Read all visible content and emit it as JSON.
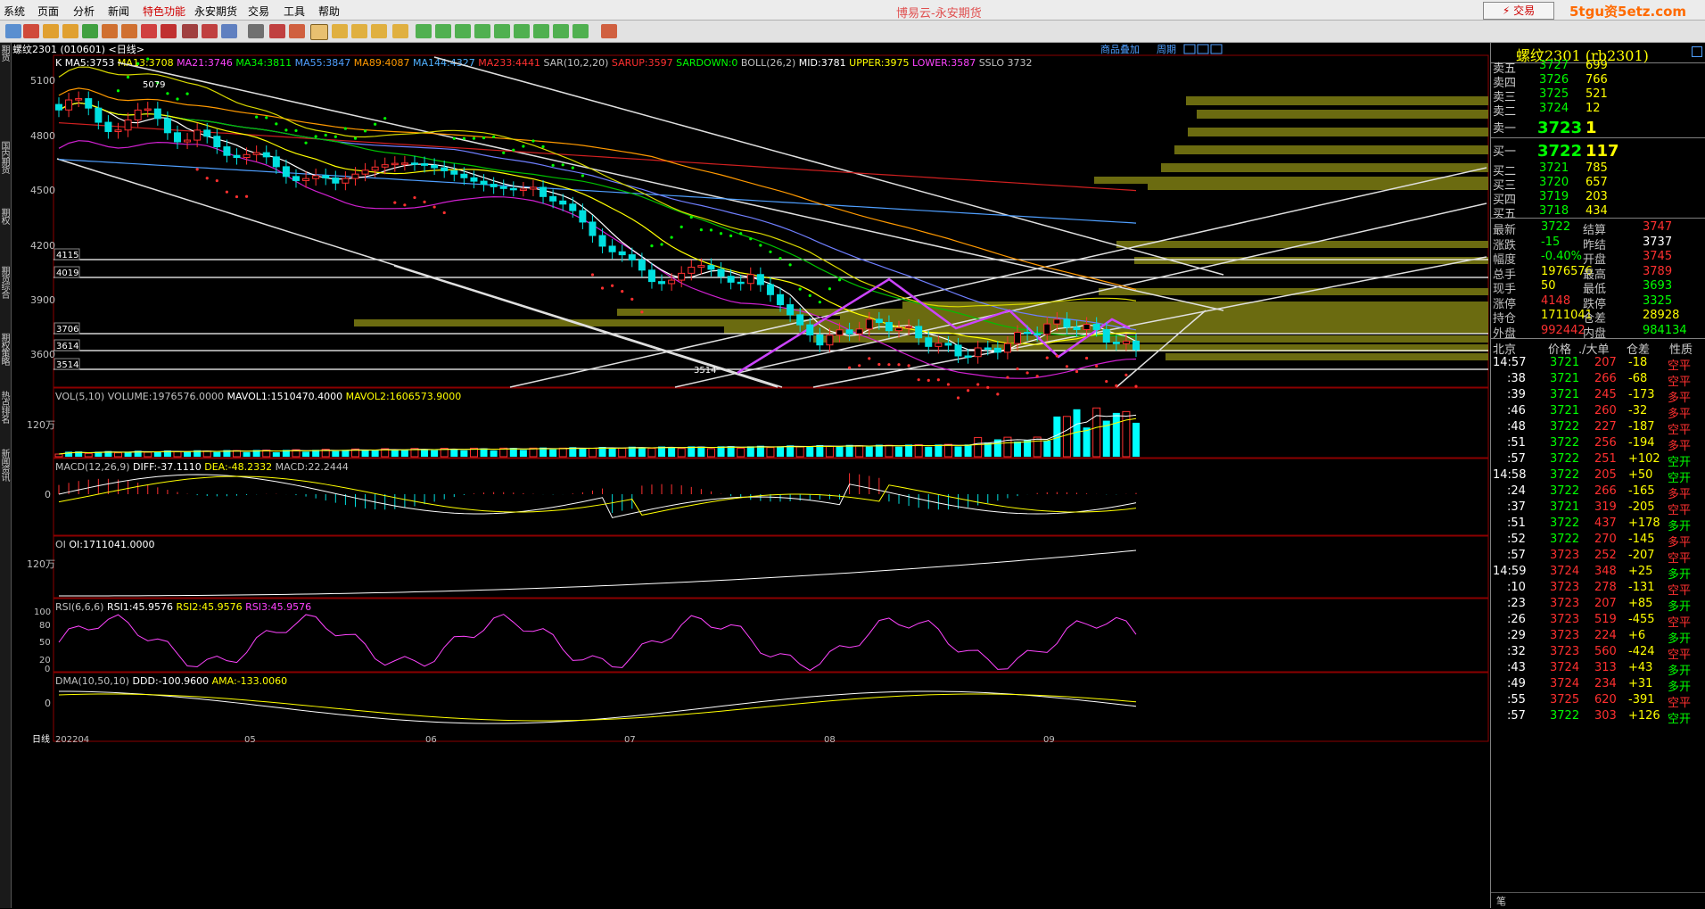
{
  "menu": [
    "系统",
    "页面",
    "分析",
    "新闻",
    "特色功能",
    "永安期货",
    "交易",
    "工具",
    "帮助"
  ],
  "app_title": "博易云-永安期货",
  "trade_button": "交易",
  "watermark": "5tgu资5etz.com",
  "side_tabs": [
    "期货",
    "国内期货",
    "期权",
    "期货综合",
    "期权策略",
    "热点排名",
    "新闻资讯"
  ],
  "chart_header": "螺纹2301 (010601) <日线>",
  "chart_links": [
    "商品叠加",
    "周期"
  ],
  "main_indicator_row": [
    {
      "t": "K",
      "c": "#ffffff"
    },
    {
      "t": "MA5:3753",
      "c": "#ffffff"
    },
    {
      "t": "MA13:3708",
      "c": "#ffff00"
    },
    {
      "t": "MA21:3746",
      "c": "#ff44ff"
    },
    {
      "t": "MA34:3811",
      "c": "#00ff00"
    },
    {
      "t": "MA55:3847",
      "c": "#4f9fff"
    },
    {
      "t": "MA89:4087",
      "c": "#ff9900"
    },
    {
      "t": "MA144:4327",
      "c": "#4fb0ff"
    },
    {
      "t": "MA233:4441",
      "c": "#ff3030"
    },
    {
      "t": "SAR(10,2,20)",
      "c": "#c0c0c0"
    },
    {
      "t": "SARUP:3597",
      "c": "#ff3030"
    },
    {
      "t": "SARDOWN:0",
      "c": "#00ff00"
    },
    {
      "t": "BOLL(26,2)",
      "c": "#c0c0c0"
    },
    {
      "t": "MID:3781",
      "c": "#ffffff"
    },
    {
      "t": "UPPER:3975",
      "c": "#ffff00"
    },
    {
      "t": "LOWER:3587",
      "c": "#ff44ff"
    },
    {
      "t": "SSLO 3732",
      "c": "#c0c0c0"
    }
  ],
  "price_axis": [
    "5100",
    "4800",
    "4500",
    "4200",
    "3900",
    "3600"
  ],
  "price_levels": [
    "4115",
    "4019",
    "3706",
    "3614",
    "3514"
  ],
  "annotations": {
    "high": "5079",
    "low": "3514"
  },
  "vol_row": [
    {
      "t": "VOL(5,10)",
      "c": "#c0c0c0"
    },
    {
      "t": "VOLUME:1976576.0000",
      "c": "#c0c0c0"
    },
    {
      "t": "MAVOL1:1510470.4000",
      "c": "#ffffff"
    },
    {
      "t": "MAVOL2:1606573.9000",
      "c": "#ffff00"
    }
  ],
  "vol_axis": "120万",
  "macd_row": [
    {
      "t": "MACD(12,26,9)",
      "c": "#c0c0c0"
    },
    {
      "t": "DIFF:-37.1110",
      "c": "#ffffff"
    },
    {
      "t": "DEA:-48.2332",
      "c": "#ffff00"
    },
    {
      "t": "MACD:22.2444",
      "c": "#c0c0c0"
    }
  ],
  "macd_axis": "0",
  "oi_row": [
    {
      "t": "OI",
      "c": "#c0c0c0"
    },
    {
      "t": "OI:1711041.0000",
      "c": "#ffffff"
    }
  ],
  "oi_axis": "120万",
  "rsi_row": [
    {
      "t": "RSI(6,6,6)",
      "c": "#c0c0c0"
    },
    {
      "t": "RSI1:45.9576",
      "c": "#ffffff"
    },
    {
      "t": "RSI2:45.9576",
      "c": "#ffff00"
    },
    {
      "t": "RSI3:45.9576",
      "c": "#ff44ff"
    }
  ],
  "rsi_axis": [
    "100",
    "80",
    "50",
    "20",
    "0"
  ],
  "dma_row": [
    {
      "t": "DMA(10,50,10)",
      "c": "#c0c0c0"
    },
    {
      "t": "DDD:-100.9600",
      "c": "#ffffff"
    },
    {
      "t": "AMA:-133.0060",
      "c": "#ffff00"
    }
  ],
  "dma_axis": "0",
  "time_axis": [
    "日线",
    "202204",
    "05",
    "06",
    "07",
    "08",
    "09"
  ],
  "quote": {
    "title": "螺纹2301 (rb2301)",
    "asks": [
      [
        "卖五",
        "3727",
        "699"
      ],
      [
        "卖四",
        "3726",
        "766"
      ],
      [
        "卖三",
        "3725",
        "521"
      ],
      [
        "卖二",
        "3724",
        "12"
      ]
    ],
    "ask1": [
      "卖一",
      "3723",
      "1"
    ],
    "bid1": [
      "买一",
      "3722",
      "117"
    ],
    "bids": [
      [
        "买二",
        "3721",
        "785"
      ],
      [
        "买三",
        "3720",
        "657"
      ],
      [
        "买四",
        "3719",
        "203"
      ],
      [
        "买五",
        "3718",
        "434"
      ]
    ],
    "stats": [
      [
        {
          "t": "最新",
          "c": "#c0c0c0"
        },
        {
          "t": "3722",
          "c": "#00ff00"
        },
        {
          "t": "结算",
          "c": "#c0c0c0"
        },
        {
          "t": "3747",
          "c": "#ff3030"
        }
      ],
      [
        {
          "t": "涨跌",
          "c": "#c0c0c0"
        },
        {
          "t": "-15",
          "c": "#00ff00"
        },
        {
          "t": "昨结",
          "c": "#c0c0c0"
        },
        {
          "t": "3737",
          "c": "#ffffff"
        }
      ],
      [
        {
          "t": "幅度",
          "c": "#c0c0c0"
        },
        {
          "t": "-0.40%",
          "c": "#00ff00"
        },
        {
          "t": "开盘",
          "c": "#c0c0c0"
        },
        {
          "t": "3745",
          "c": "#ff3030"
        }
      ],
      [
        {
          "t": "总手",
          "c": "#c0c0c0"
        },
        {
          "t": "1976576",
          "c": "#ffff00"
        },
        {
          "t": "最高",
          "c": "#c0c0c0"
        },
        {
          "t": "3789",
          "c": "#ff3030"
        }
      ],
      [
        {
          "t": "现手",
          "c": "#c0c0c0"
        },
        {
          "t": "50",
          "c": "#ffff00"
        },
        {
          "t": "最低",
          "c": "#c0c0c0"
        },
        {
          "t": "3693",
          "c": "#00ff00"
        }
      ],
      [
        {
          "t": "涨停",
          "c": "#c0c0c0"
        },
        {
          "t": "4148",
          "c": "#ff3030"
        },
        {
          "t": "跌停",
          "c": "#c0c0c0"
        },
        {
          "t": "3325",
          "c": "#00ff00"
        }
      ],
      [
        {
          "t": "持仓",
          "c": "#c0c0c0"
        },
        {
          "t": "1711041",
          "c": "#ffff00"
        },
        {
          "t": "仓差",
          "c": "#c0c0c0"
        },
        {
          "t": "28928",
          "c": "#ffff00"
        }
      ],
      [
        {
          "t": "外盘",
          "c": "#c0c0c0"
        },
        {
          "t": "992442",
          "c": "#ff3030"
        },
        {
          "t": "内盘",
          "c": "#c0c0c0"
        },
        {
          "t": "984134",
          "c": "#00ff00"
        }
      ]
    ],
    "tick_header": [
      "北京",
      "价格",
      "./大单",
      "仓差",
      "性质"
    ],
    "ticks": [
      [
        "14:57",
        "3721",
        "207",
        "-18",
        "空平"
      ],
      [
        ":38",
        "3721",
        "266",
        "-68",
        "空平"
      ],
      [
        ":39",
        "3721",
        "245",
        "-173",
        "多平"
      ],
      [
        ":46",
        "3721",
        "260",
        "-32",
        "多平"
      ],
      [
        ":48",
        "3722",
        "227",
        "-187",
        "空平"
      ],
      [
        ":51",
        "3722",
        "256",
        "-194",
        "多平"
      ],
      [
        ":57",
        "3722",
        "251",
        "+102",
        "空开"
      ],
      [
        "14:58",
        "3722",
        "205",
        "+50",
        "空开"
      ],
      [
        ":24",
        "3722",
        "266",
        "-165",
        "多平"
      ],
      [
        ":37",
        "3721",
        "319",
        "-205",
        "空平"
      ],
      [
        ":51",
        "3722",
        "437",
        "+178",
        "多开"
      ],
      [
        ":52",
        "3722",
        "270",
        "-145",
        "多平"
      ],
      [
        ":57",
        "3723",
        "252",
        "-207",
        "空平"
      ],
      [
        "14:59",
        "3724",
        "348",
        "+25",
        "多开"
      ],
      [
        ":10",
        "3723",
        "278",
        "-131",
        "空平"
      ],
      [
        ":23",
        "3723",
        "207",
        "+85",
        "多开"
      ],
      [
        ":26",
        "3723",
        "519",
        "-455",
        "空平"
      ],
      [
        ":29",
        "3723",
        "224",
        "+6",
        "多开"
      ],
      [
        ":32",
        "3723",
        "560",
        "-424",
        "空平"
      ],
      [
        ":43",
        "3724",
        "313",
        "+43",
        "多开"
      ],
      [
        ":49",
        "3724",
        "234",
        "+31",
        "多开"
      ],
      [
        ":55",
        "3725",
        "620",
        "-391",
        "空平"
      ],
      [
        ":57",
        "3722",
        "303",
        "+126",
        "空开"
      ]
    ],
    "footer": "笔"
  }
}
